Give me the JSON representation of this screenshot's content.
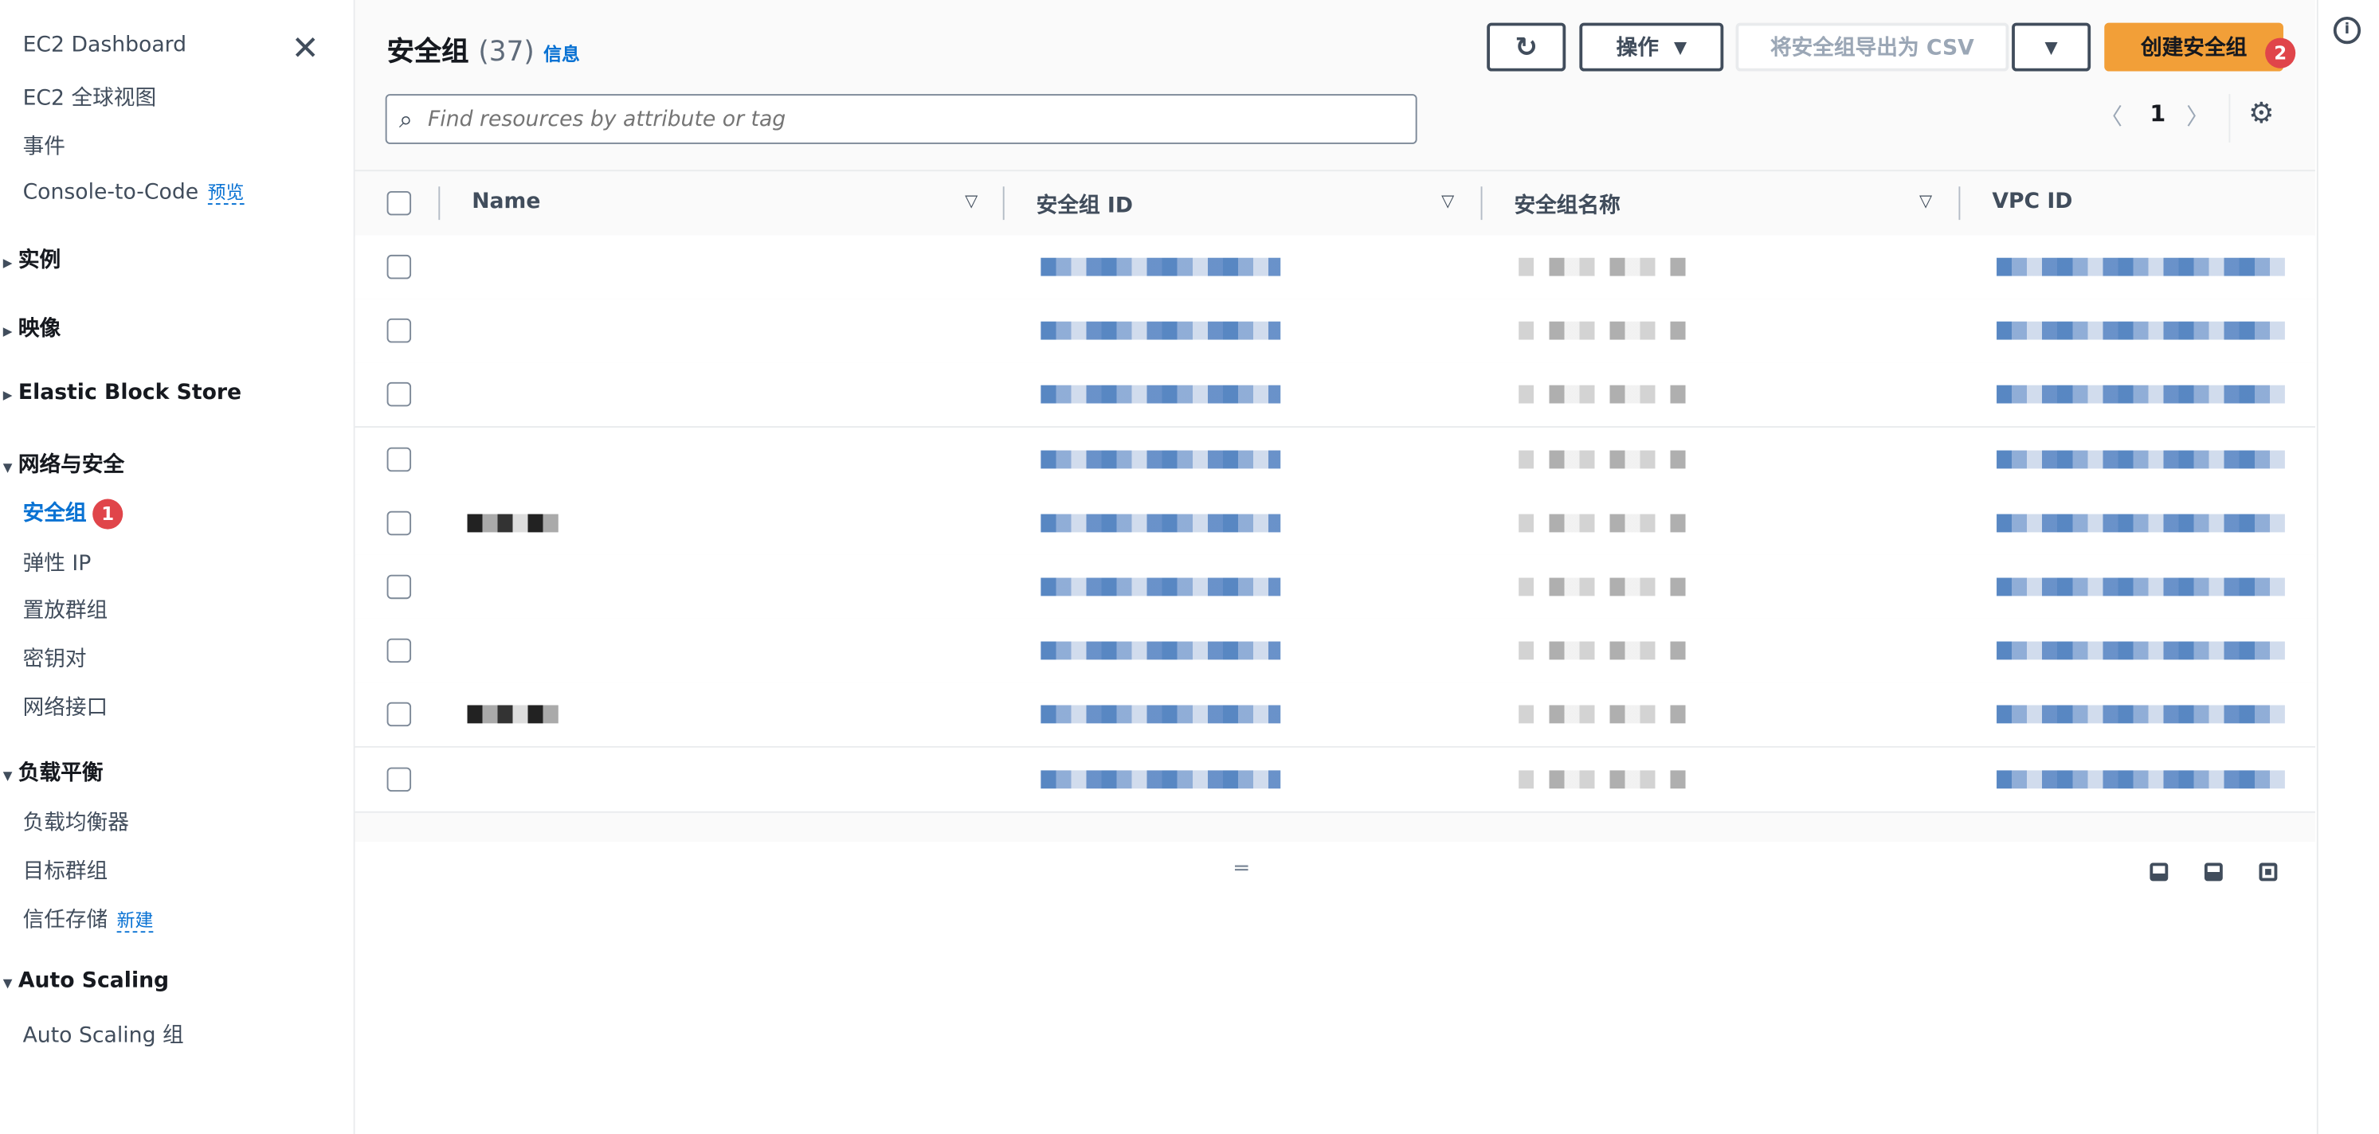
{
  "sidebar": {
    "close_icon": "close-icon",
    "top_items": [
      {
        "label": "EC2 Dashboard"
      },
      {
        "label": "EC2 全球视图"
      },
      {
        "label": "事件"
      },
      {
        "label": "Console-to-Code",
        "tag": "预览"
      }
    ],
    "sections": [
      {
        "label": "实例",
        "expanded": false
      },
      {
        "label": "映像",
        "expanded": false
      },
      {
        "label": "Elastic Block Store",
        "expanded": false
      },
      {
        "label": "网络与安全",
        "expanded": true,
        "items": [
          {
            "label": "安全组",
            "active": true,
            "badge": "1"
          },
          {
            "label": "弹性 IP"
          },
          {
            "label": "置放群组"
          },
          {
            "label": "密钥对"
          },
          {
            "label": "网络接口"
          }
        ]
      },
      {
        "label": "负载平衡",
        "expanded": true,
        "items": [
          {
            "label": "负载均衡器"
          },
          {
            "label": "目标群组"
          },
          {
            "label": "信任存储",
            "tag": "新建"
          }
        ]
      },
      {
        "label": "Auto Scaling",
        "expanded": true,
        "items": [
          {
            "label": "Auto Scaling 组"
          }
        ]
      }
    ]
  },
  "header": {
    "title": "安全组",
    "count": "(37)",
    "info": "信息",
    "actions_label": "操作",
    "export_label": "将安全组导出为 CSV",
    "create_label": "创建安全组",
    "create_badge": "2",
    "accent_color": "#f29f38"
  },
  "search": {
    "placeholder": "Find resources by attribute or tag",
    "value": ""
  },
  "pagination": {
    "current_page": "1"
  },
  "table": {
    "columns": [
      "Name",
      "安全组 ID",
      "安全组名称",
      "VPC ID"
    ],
    "row_count_visible": 9
  }
}
